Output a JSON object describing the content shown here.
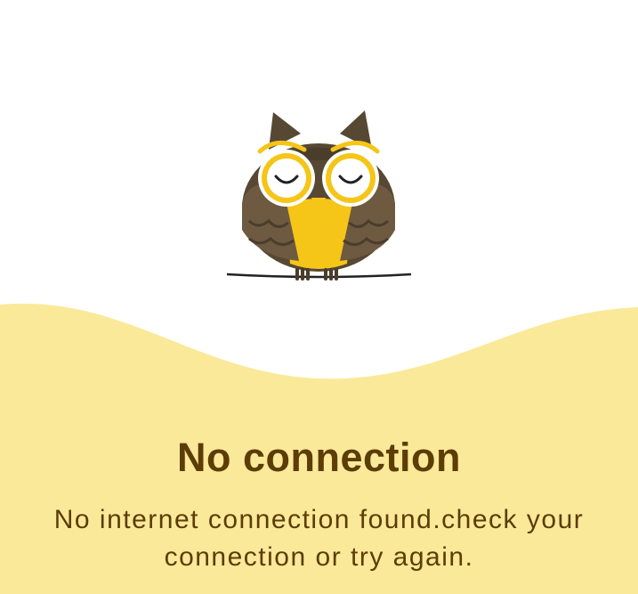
{
  "error_screen": {
    "illustration": "sleeping-owl-on-wire",
    "title": "No connection",
    "message": "No internet connection found.check your connection or try again."
  },
  "colors": {
    "background": "#ffffff",
    "wave": "#fbe99a",
    "text": "#5c3d06",
    "owl_dark": "#564833",
    "owl_mid": "#6e5a41",
    "owl_yellow": "#f5c518"
  }
}
